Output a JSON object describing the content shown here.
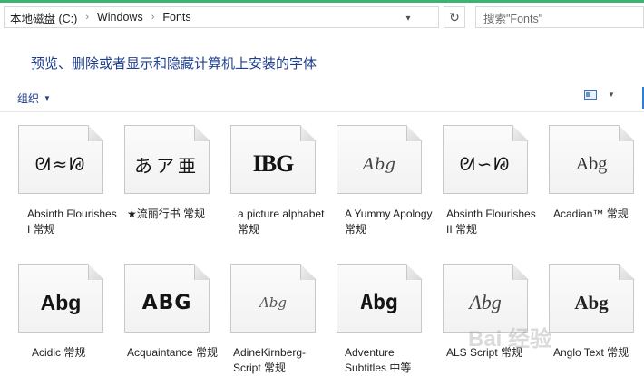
{
  "address": {
    "crumbs": [
      "本地磁盘 (C:)",
      "Windows",
      "Fonts"
    ],
    "search_placeholder": "搜索\"Fonts\""
  },
  "header": {
    "title": "预览、删除或者显示和隐藏计算机上安装的字体"
  },
  "toolbar": {
    "organize_label": "组织"
  },
  "fonts": [
    {
      "name": "Absinth Flourishes I 常规",
      "sample": "ᘛ≈ᘘ"
    },
    {
      "name": "★流丽行书 常规",
      "sample": "あア亜"
    },
    {
      "name": "a picture alphabet 常规",
      "sample": "IBG"
    },
    {
      "name": "A Yummy Apology 常规",
      "sample": "Abg"
    },
    {
      "name": "Absinth Flourishes II 常规",
      "sample": "ᘛ∽ᘘ"
    },
    {
      "name": "Acadian™ 常规",
      "sample": "Abg"
    },
    {
      "name": "Acidic 常规",
      "sample": "Abg"
    },
    {
      "name": "Acquaintance 常规",
      "sample": "ABG"
    },
    {
      "name": "AdineKirnberg-Script 常规",
      "sample": "Abg"
    },
    {
      "name": "Adventure Subtitles 中等",
      "sample": "Abg"
    },
    {
      "name": "ALS Script 常规",
      "sample": "Abg"
    },
    {
      "name": "Anglo Text 常规",
      "sample": "Abg"
    }
  ],
  "watermark": "Bai 经验"
}
